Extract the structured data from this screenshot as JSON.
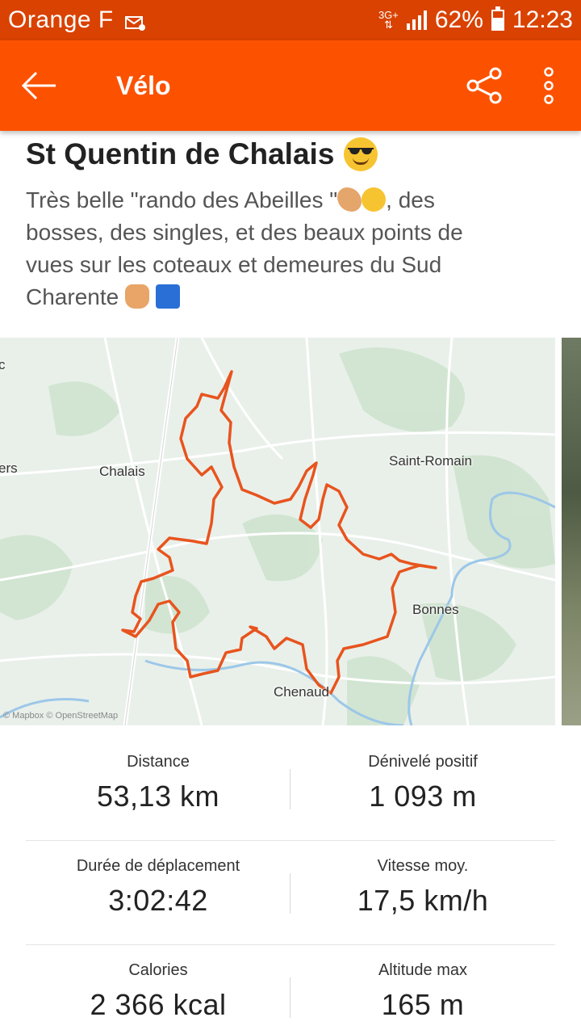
{
  "status_bar": {
    "carrier": "Orange F",
    "network": "3G+",
    "battery": "62%",
    "time": "12:23",
    "battery_level": 0.62
  },
  "app_bar": {
    "title": "Vélo",
    "back_icon": "arrow-left-icon",
    "share_icon": "share-icon",
    "more_icon": "more-vertical-icon"
  },
  "activity": {
    "title": "St Quentin de Chalais",
    "description_lines": [
      "Très belle  \"rando des Abeilles \"",
      ", des",
      "bosses, des singles,  et des beaux points de",
      "vues sur les coteaux et demeures du Sud",
      "Charente "
    ]
  },
  "map": {
    "labels": {
      "c": "c",
      "ers": "ers",
      "chalais": "Chalais",
      "saint_romain": "Saint-Romain",
      "bonnes": "Bonnes",
      "chenaud": "Chenaud"
    },
    "attribution": "© Mapbox © OpenStreetMap",
    "route_color": "#e8541e"
  },
  "stats": [
    {
      "label": "Distance",
      "value": "53,13 km"
    },
    {
      "label": "Dénivelé positif",
      "value": "1 093 m"
    },
    {
      "label": "Durée de déplacement",
      "value": "3:02:42"
    },
    {
      "label": "Vitesse moy.",
      "value": "17,5 km/h"
    },
    {
      "label": "Calories",
      "value": "2 366 kcal"
    },
    {
      "label": "Altitude max",
      "value": "165 m"
    }
  ],
  "colors": {
    "brand": "#fc5200",
    "status_bar": "#d94200"
  }
}
